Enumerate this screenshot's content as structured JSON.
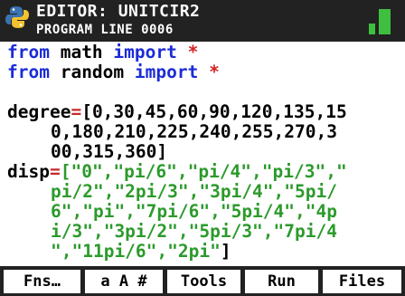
{
  "titlebar": {
    "line1": "EDITOR: UNITCIR2",
    "line2": "PROGRAM LINE 0006",
    "icons": {
      "logo": "python-logo-icon",
      "battery": "battery-icon"
    }
  },
  "code": {
    "line1": {
      "kw1": "from",
      "mid": " math ",
      "kw2": "import",
      "ast": "*"
    },
    "line2": {
      "kw1": "from",
      "mid": " random ",
      "kw2": "import",
      "ast": "*"
    },
    "degree_var": "degree",
    "eq": "=",
    "degree_l1": "[0,30,45,60,90,120,135,15",
    "degree_l2": "0,180,210,225,240,255,270,3",
    "degree_l3": "00,315,360]",
    "disp_var": "disp",
    "disp_l1": "[\"0\",\"pi/6\",\"pi/4\",\"pi/3\",\"",
    "disp_l2": "pi/2\",\"2pi/3\",\"3pi/4\",\"5pi/",
    "disp_l3": "6\",\"pi\",\"7pi/6\",\"5pi/4\",\"4p",
    "disp_l4": "i/3\",\"3pi/2\",\"5pi/3\",\"7pi/4",
    "disp_l5": "\",\"11pi/6\",\"2pi\"",
    "disp_close": "]"
  },
  "softkeys": {
    "fns": "Fns…",
    "chars": "a A #",
    "tools": "Tools",
    "run": "Run",
    "files": "Files"
  },
  "colors": {
    "keyword": "#1b2bd6",
    "operator": "#c42a2a",
    "string": "#2b9a2b",
    "bar": "#222222"
  }
}
